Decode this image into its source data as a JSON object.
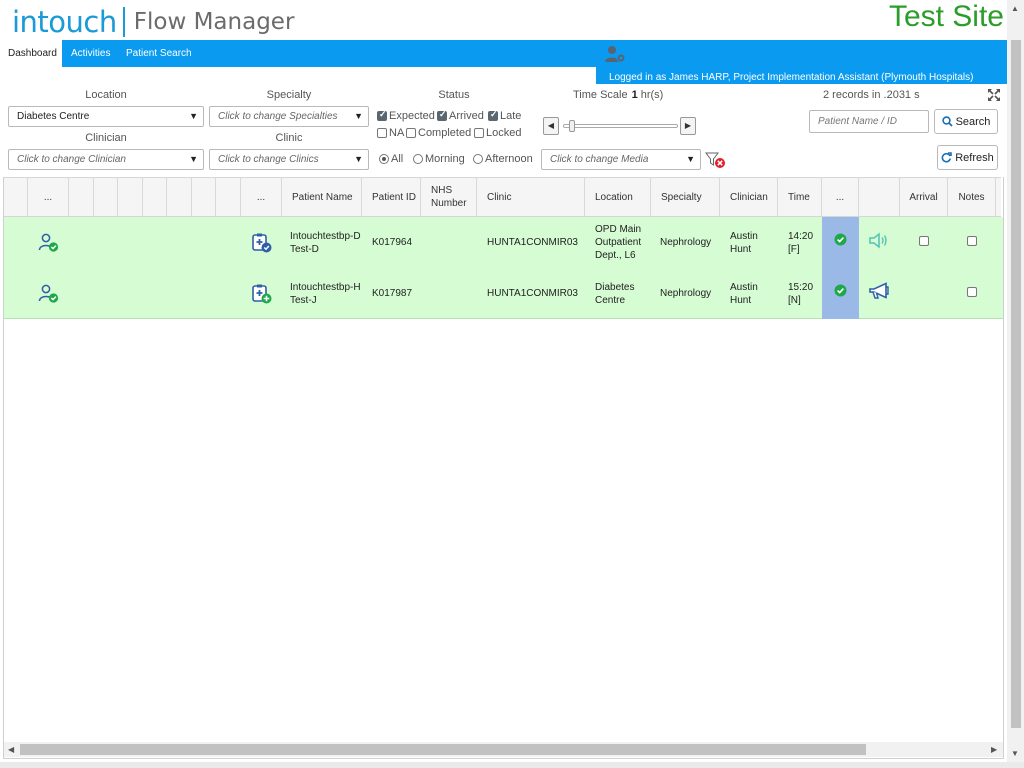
{
  "brand": {
    "logo": "intouch",
    "product": "Flow Manager",
    "site": "Test Site"
  },
  "nav": {
    "tabs": [
      "Dashboard",
      "Activities",
      "Patient Search"
    ]
  },
  "user": {
    "logged_in": "Logged in as James HARP, Project Implementation Assistant (Plymouth Hospitals)"
  },
  "filters": {
    "location_label": "Location",
    "location_value": "Diabetes Centre",
    "specialty_label": "Specialty",
    "specialty_placeholder": "Click to change Specialties",
    "clinician_label": "Clinician",
    "clinician_placeholder": "Click to change Clinician",
    "clinic_label": "Clinic",
    "clinic_placeholder": "Click to change Clinics",
    "status_label": "Status",
    "status": {
      "expected": {
        "label": "Expected",
        "checked": true
      },
      "arrived": {
        "label": "Arrived",
        "checked": true
      },
      "late": {
        "label": "Late",
        "checked": true
      },
      "na": {
        "label": "NA",
        "checked": false
      },
      "completed": {
        "label": "Completed",
        "checked": false
      },
      "locked": {
        "label": "Locked",
        "checked": false
      }
    },
    "session": {
      "all": "All",
      "morning": "Morning",
      "afternoon": "Afternoon",
      "selected": "All"
    },
    "media_placeholder": "Click to change Media",
    "time_scale_label": "Time Scale",
    "time_scale_value": "1",
    "time_scale_unit": "hr(s)",
    "time_scale_slider_fraction": 0.05
  },
  "records_text": "2 records in .2031 s",
  "search": {
    "placeholder": "Patient Name / ID",
    "button": "Search",
    "refresh": "Refresh"
  },
  "grid": {
    "headers": {
      "dots1": "...",
      "dots2": "...",
      "patient_name": "Patient Name",
      "patient_id": "Patient ID",
      "nhs_number": "NHS Number",
      "clinic": "Clinic",
      "location": "Location",
      "specialty": "Specialty",
      "clinician": "Clinician",
      "time": "Time",
      "dots3": "...",
      "arrival": "Arrival",
      "notes": "Notes"
    },
    "rows": [
      {
        "patient_name": "Intouchtestbp-D Test-D",
        "patient_id": "K017964",
        "nhs_number": "",
        "clinic": "HUNTA1CONMIR03",
        "location": "OPD Main Outpatient Dept., L6",
        "specialty": "Nephrology",
        "clinician": "Austin Hunt",
        "time": "14:20 [F]",
        "arrival_checked": false,
        "notes_checked": false
      },
      {
        "patient_name": "Intouchtestbp-H Test-J",
        "patient_id": "K017987",
        "nhs_number": "",
        "clinic": "HUNTA1CONMIR03",
        "location": "Diabetes Centre",
        "specialty": "Nephrology",
        "clinician": "Austin Hunt",
        "time": "15:20 [N]",
        "notes_checked": false
      }
    ]
  },
  "colors": {
    "nav": "#0a9bf0",
    "brand": "#1a9ad6",
    "site": "#2a9d2a",
    "row": "#d5fcd2",
    "ok_column": "#9ab9e6",
    "ok_icon": "#1ea84a"
  }
}
